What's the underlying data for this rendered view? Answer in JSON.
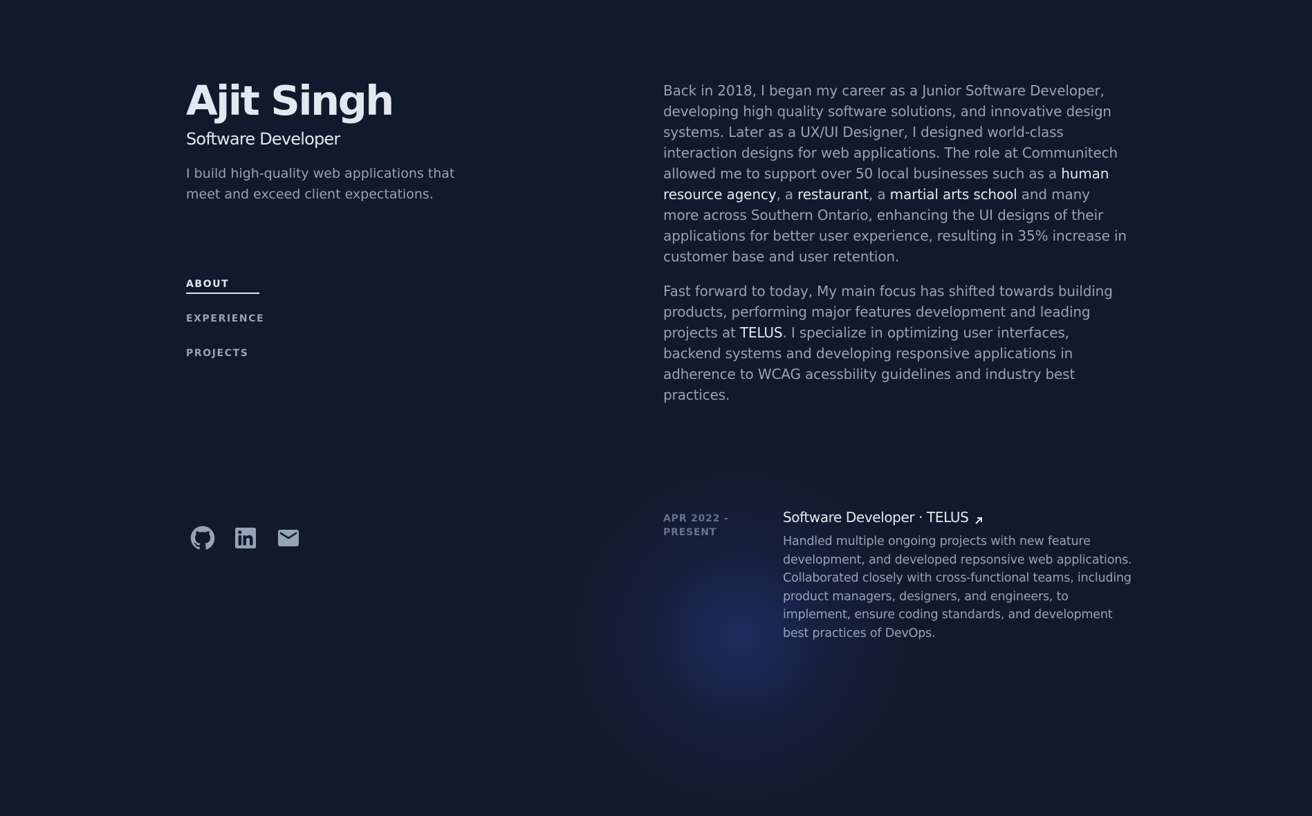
{
  "header": {
    "name": "Ajit Singh",
    "role": "Software Developer",
    "tagline": "I build high-quality web applications that meet and exceed client expectations."
  },
  "nav": {
    "items": [
      {
        "label": "ABOUT",
        "active": true
      },
      {
        "label": "EXPERIENCE",
        "active": false
      },
      {
        "label": "PROJECTS",
        "active": false
      }
    ]
  },
  "socials": [
    {
      "icon": "github-icon"
    },
    {
      "icon": "linkedin-icon"
    },
    {
      "icon": "mail-icon"
    }
  ],
  "about": {
    "p1_a": "Back in 2018, I began my career as a Junior Software Developer, developing high quality software solutions, and innovative design systems. Later as a UX/UI Designer, I designed world-class interaction designs for web applications. The role at Communitech allowed me to support over 50 local businesses such as a ",
    "p1_link1": "human resource agency",
    "p1_b": ", a ",
    "p1_link2": "restaurant",
    "p1_c": ", a ",
    "p1_link3": "martial arts school",
    "p1_d": " and many more across Southern Ontario, enhancing the UI designs of their applications for better user experience, resulting in 35% increase in customer base and user retention.",
    "p2_a": "Fast forward to today, My main focus has shifted towards building products, performing major features development and leading projects at ",
    "p2_link1": "TELUS",
    "p2_b": ". I specialize in optimizing user interfaces, backend systems and developing responsive applications in adherence to WCAG acessbility guidelines and industry best practices."
  },
  "experience": [
    {
      "date": "APR 2022 - PRESENT",
      "title": "Software Developer · TELUS",
      "description": "Handled multiple ongoing projects with new feature development, and developed repsonsive web applications. Collaborated closely with cross-functional teams, including product managers, designers, and engineers, to implement, ensure coding standards, and development best practices of DevOps."
    }
  ],
  "colors": {
    "background": "#111a2c",
    "heading": "#e2e8f0",
    "body_text": "#94a3b8",
    "muted": "#64748b"
  }
}
